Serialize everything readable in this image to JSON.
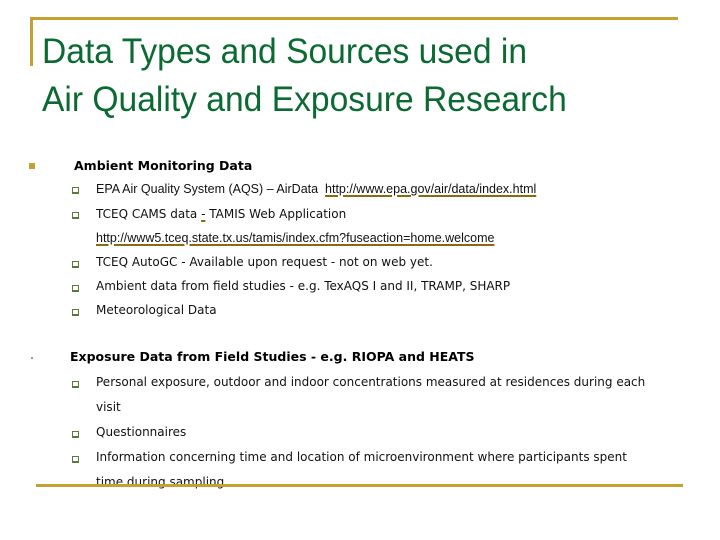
{
  "slide": {
    "title_line1": "Data Types and Sources used in",
    "title_line2": "Air Quality and Exposure Research",
    "colors": {
      "title": "#0b6a32",
      "accent_rule": "#c4a133",
      "bullet_l1": "#c4a133",
      "bullet_l2": "#5d7a3a"
    },
    "sections": [
      {
        "heading": "Ambient Monitoring Data",
        "bullet_icon": "square-bullet-icon",
        "items": [
          {
            "text": "EPA Air Quality System (AQS) – AirData",
            "link": "http://www.epa.gov/air/data/index.html"
          },
          {
            "text_before": "TCEQ CAMS data ",
            "link_dash": "-",
            "text_after": " TAMIS Web Application",
            "link": "http://www5.tceq.state.tx.us/tamis/index.cfm?fuseaction=home.welcome"
          },
          {
            "text": "TCEQ AutoGC - Available upon request - not on web yet."
          },
          {
            "text": "Ambient data from field studies - e.g. TexAQS I and II, TRAMP, SHARP"
          },
          {
            "text": "Meteorological Data"
          }
        ]
      },
      {
        "heading": "Exposure Data from Field Studies - e.g. RIOPA and HEATS",
        "bullet_icon": "dot-bullet-icon",
        "items": [
          {
            "line1": "Personal exposure, outdoor and indoor concentrations measured at residences during each",
            "line2": "visit"
          },
          {
            "text": "Questionnaires"
          },
          {
            "line1": "Information concerning time and location of microenvironment where participants spent",
            "line2": "time during sampling"
          }
        ]
      }
    ]
  }
}
